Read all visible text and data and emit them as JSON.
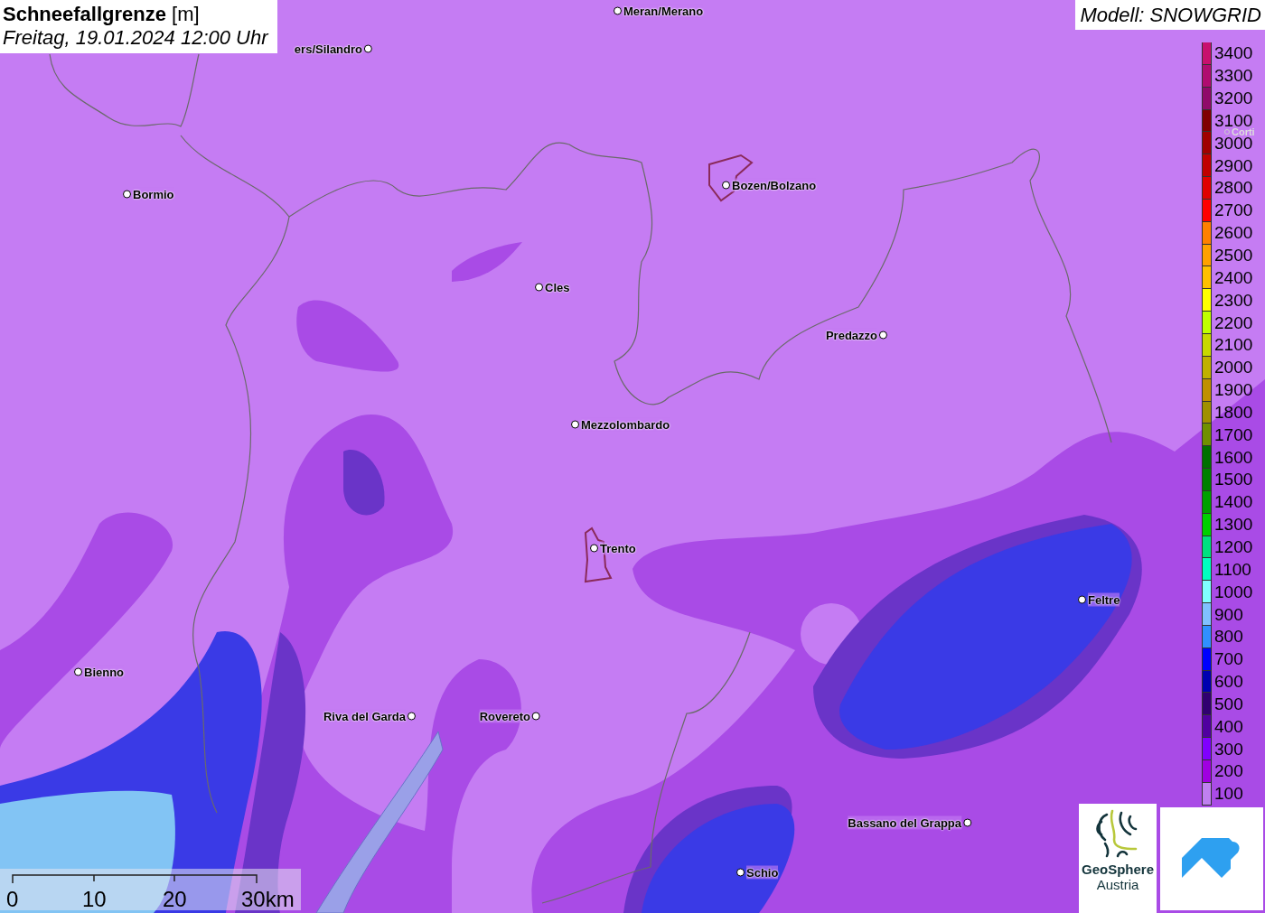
{
  "header": {
    "title": "Schneefallgrenze",
    "unit": "[m]",
    "date": "Freitag, 19.01.2024 12:00 Uhr"
  },
  "model": "Modell: SNOWGRID",
  "cities": [
    {
      "name": "ers/Silandro",
      "kind": "town"
    },
    {
      "name": "Meran/Merano",
      "kind": "town"
    },
    {
      "name": "Bormio",
      "kind": "town"
    },
    {
      "name": "Bozen/Bolzano",
      "kind": "town"
    },
    {
      "name": "Cles",
      "kind": "town"
    },
    {
      "name": "Predazzo",
      "kind": "town"
    },
    {
      "name": "Mezzolombardo",
      "kind": "town"
    },
    {
      "name": "Trento",
      "kind": "town"
    },
    {
      "name": "Feltre",
      "kind": "town"
    },
    {
      "name": "Bienno",
      "kind": "town"
    },
    {
      "name": "Riva del Garda",
      "kind": "town"
    },
    {
      "name": "Rovereto",
      "kind": "town"
    },
    {
      "name": "Bassano del Grappa",
      "kind": "town"
    },
    {
      "name": "Schio",
      "kind": "town"
    },
    {
      "name": "Corti",
      "kind": "faded"
    }
  ],
  "legend": [
    {
      "label": "3400",
      "color": "#c8106e"
    },
    {
      "label": "3300",
      "color": "#b00c70"
    },
    {
      "label": "3200",
      "color": "#900a6a"
    },
    {
      "label": "3100",
      "color": "#800000"
    },
    {
      "label": "3000",
      "color": "#a00000"
    },
    {
      "label": "2900",
      "color": "#c00000"
    },
    {
      "label": "2800",
      "color": "#e00000"
    },
    {
      "label": "2700",
      "color": "#ff0000"
    },
    {
      "label": "2600",
      "color": "#ff8000"
    },
    {
      "label": "2500",
      "color": "#ffa000"
    },
    {
      "label": "2400",
      "color": "#ffc000"
    },
    {
      "label": "2300",
      "color": "#ffff00"
    },
    {
      "label": "2200",
      "color": "#c0ff00"
    },
    {
      "label": "2100",
      "color": "#c8d800"
    },
    {
      "label": "2000",
      "color": "#c0b000"
    },
    {
      "label": "1900",
      "color": "#c09000"
    },
    {
      "label": "1800",
      "color": "#a09000"
    },
    {
      "label": "1700",
      "color": "#709000"
    },
    {
      "label": "1600",
      "color": "#007000"
    },
    {
      "label": "1500",
      "color": "#008000"
    },
    {
      "label": "1400",
      "color": "#00a000"
    },
    {
      "label": "1300",
      "color": "#00d000"
    },
    {
      "label": "1200",
      "color": "#00e080"
    },
    {
      "label": "1100",
      "color": "#00ffc0"
    },
    {
      "label": "1000",
      "color": "#80ffff"
    },
    {
      "label": "900",
      "color": "#80c0ff"
    },
    {
      "label": "800",
      "color": "#3090ff"
    },
    {
      "label": "700",
      "color": "#0000ff"
    },
    {
      "label": "600",
      "color": "#0000b0"
    },
    {
      "label": "500",
      "color": "#300070"
    },
    {
      "label": "400",
      "color": "#5000a0"
    },
    {
      "label": "300",
      "color": "#8000ff"
    },
    {
      "label": "200",
      "color": "#a000e0"
    },
    {
      "label": "100",
      "color": "#c080f0"
    }
  ],
  "scale": [
    "0",
    "10",
    "20",
    "30km"
  ],
  "logo": {
    "line_1": "GeoSphere",
    "line_2": "Austria"
  }
}
